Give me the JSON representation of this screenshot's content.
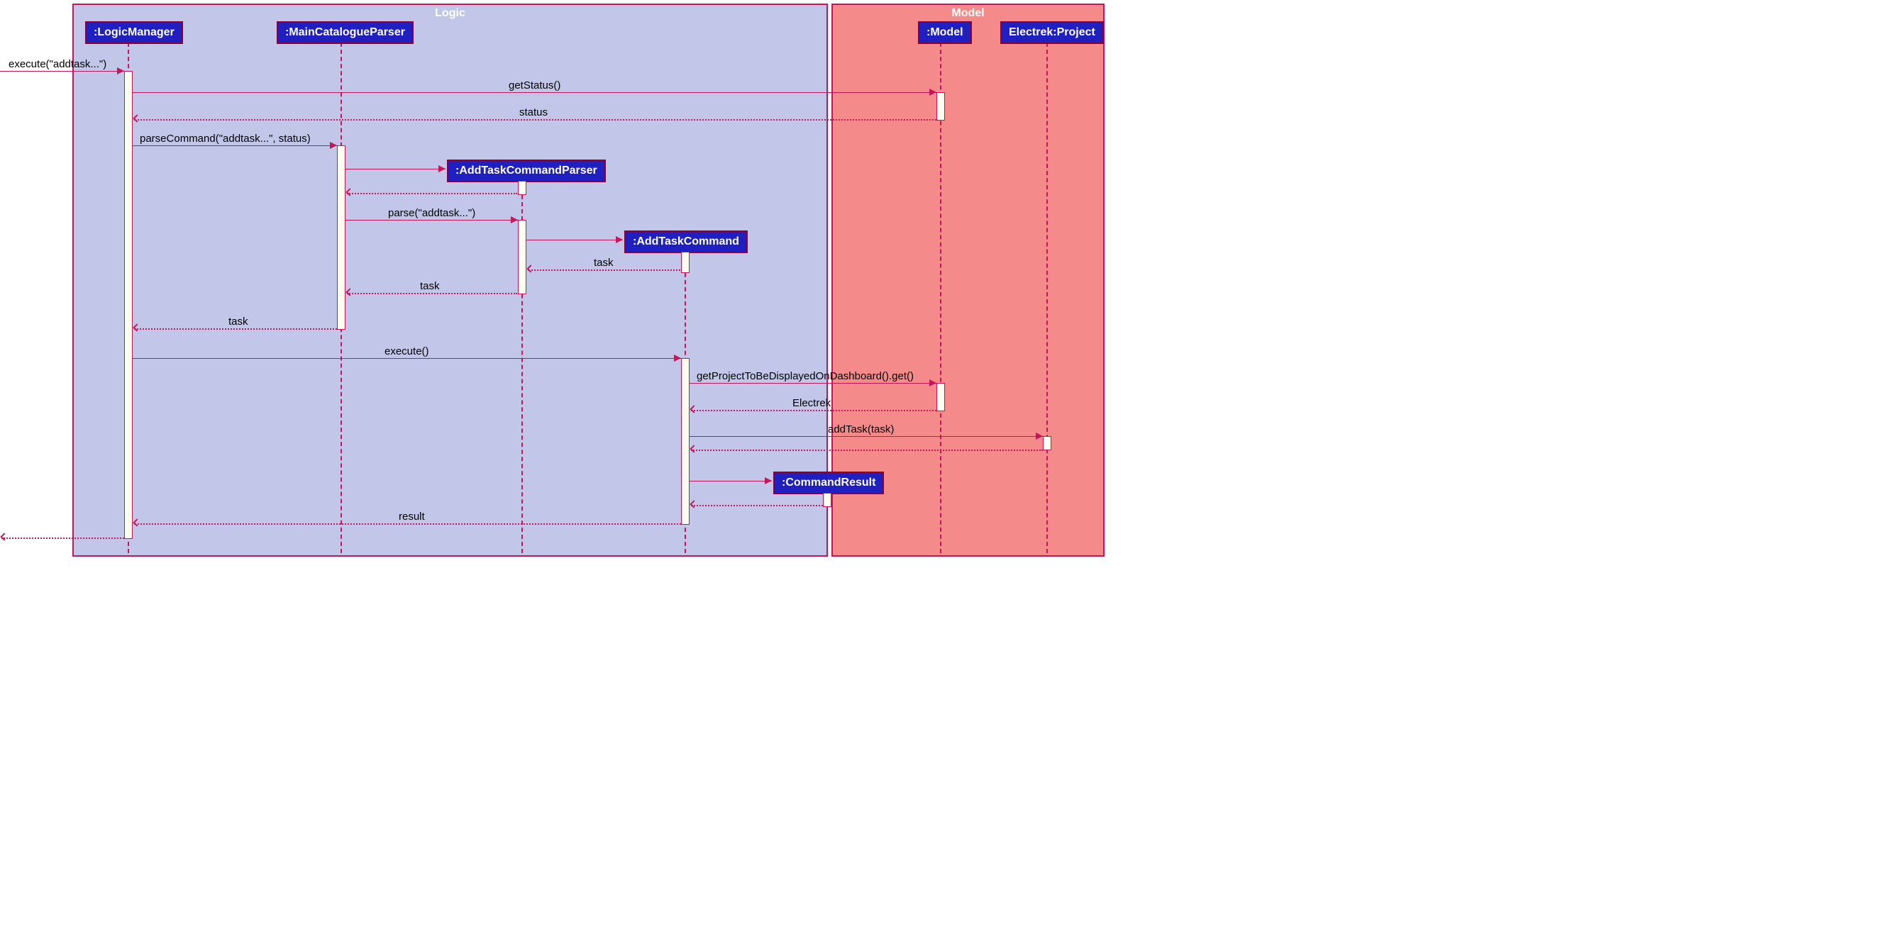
{
  "frames": {
    "logic": {
      "title": "Logic"
    },
    "model": {
      "title": "Model"
    }
  },
  "participants": {
    "logicManager": ":LogicManager",
    "mainParser": ":MainCatalogueParser",
    "addTaskParser": ":AddTaskCommandParser",
    "addTaskCmd": ":AddTaskCommand",
    "cmdResult": ":CommandResult",
    "model": ":Model",
    "project": "Electrek:Project"
  },
  "messages": {
    "m1": "execute(\"addtask...\")",
    "m2": "getStatus()",
    "m3": "status",
    "m4": "parseCommand(\"addtask...\", status)",
    "m5": "parse(\"addtask...\")",
    "m6": "task",
    "m7": "task",
    "m8": "task",
    "m9": "execute()",
    "m10": "getProjectToBeDisplayedOnDashboard().get()",
    "m11": "Electrek",
    "m12": "addTask(task)",
    "m13": "result"
  }
}
